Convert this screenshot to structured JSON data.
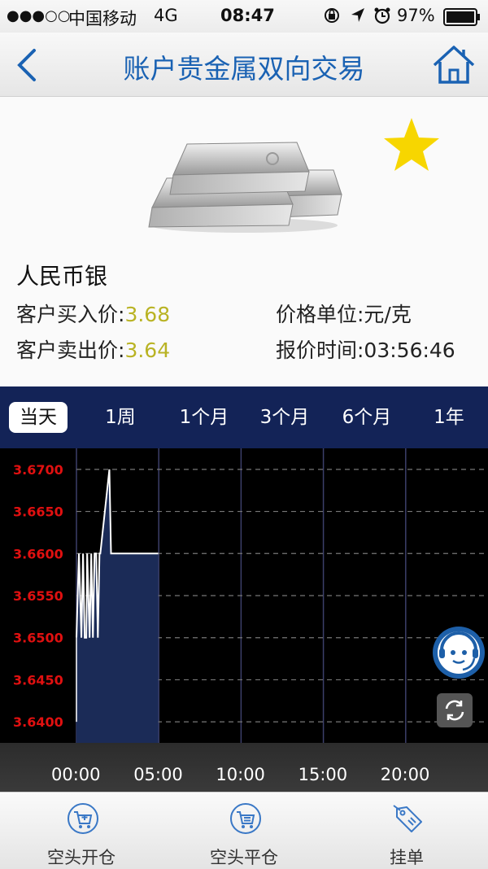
{
  "status_bar": {
    "signal": "●●●○○",
    "carrier": "中国移动",
    "network": "4G",
    "time": "08:47",
    "battery": "97%"
  },
  "nav": {
    "title": "账户贵金属双向交易",
    "back_icon": "chevron-left-icon",
    "home_icon": "home-icon"
  },
  "product": {
    "name": "人民币银",
    "favorite": true,
    "buy_label": "客户买入价:",
    "buy_value": "3.68",
    "sell_label": "客户卖出价:",
    "sell_value": "3.64",
    "unit_label": "价格单位:元/克",
    "time_label": "报价时间:03:56:46"
  },
  "tabs": [
    {
      "label": "当天",
      "active": true
    },
    {
      "label": "1周",
      "active": false
    },
    {
      "label": "1个月",
      "active": false
    },
    {
      "label": "3个月",
      "active": false
    },
    {
      "label": "6个月",
      "active": false
    },
    {
      "label": "1年",
      "active": false
    }
  ],
  "chart_data": {
    "type": "area",
    "y_tick_labels": [
      "3.6700",
      "3.6650",
      "3.6600",
      "3.6550",
      "3.6500",
      "3.6450",
      "3.6400"
    ],
    "x_tick_labels": [
      "00:00",
      "05:00",
      "10:00",
      "15:00",
      "20:00"
    ],
    "ylim": [
      3.6375,
      3.6725
    ],
    "xlim": [
      0,
      25
    ],
    "x": [
      0,
      0.15,
      0.3,
      0.4,
      0.5,
      0.6,
      0.65,
      0.8,
      0.9,
      1.0,
      1.1,
      1.2,
      1.3,
      1.4,
      1.45,
      2.0,
      2.1,
      2.2,
      2.3,
      2.4,
      2.5,
      4.97
    ],
    "y": [
      3.65,
      3.66,
      3.65,
      3.66,
      3.65,
      3.65,
      3.66,
      3.65,
      3.66,
      3.65,
      3.66,
      3.66,
      3.65,
      3.66,
      3.66,
      3.67,
      3.66,
      3.66,
      3.66,
      3.66,
      3.66,
      3.66
    ],
    "line_color": "#ffffff",
    "fill_color": "#1b2b57",
    "tick_color": "#e01010",
    "grid": true
  },
  "bottom_tabs": [
    {
      "label": "空头开仓",
      "icon": "cart-plus-icon"
    },
    {
      "label": "空头平仓",
      "icon": "cart-minus-icon"
    },
    {
      "label": "挂单",
      "icon": "tag-icon"
    }
  ],
  "floating": {
    "service_icon": "customer-service-icon",
    "refresh_icon": "refresh-icon"
  },
  "colors": {
    "accent": "#1a62b3",
    "price": "#b9b324",
    "tab_bar": "#132357",
    "star": "#f7d600"
  }
}
